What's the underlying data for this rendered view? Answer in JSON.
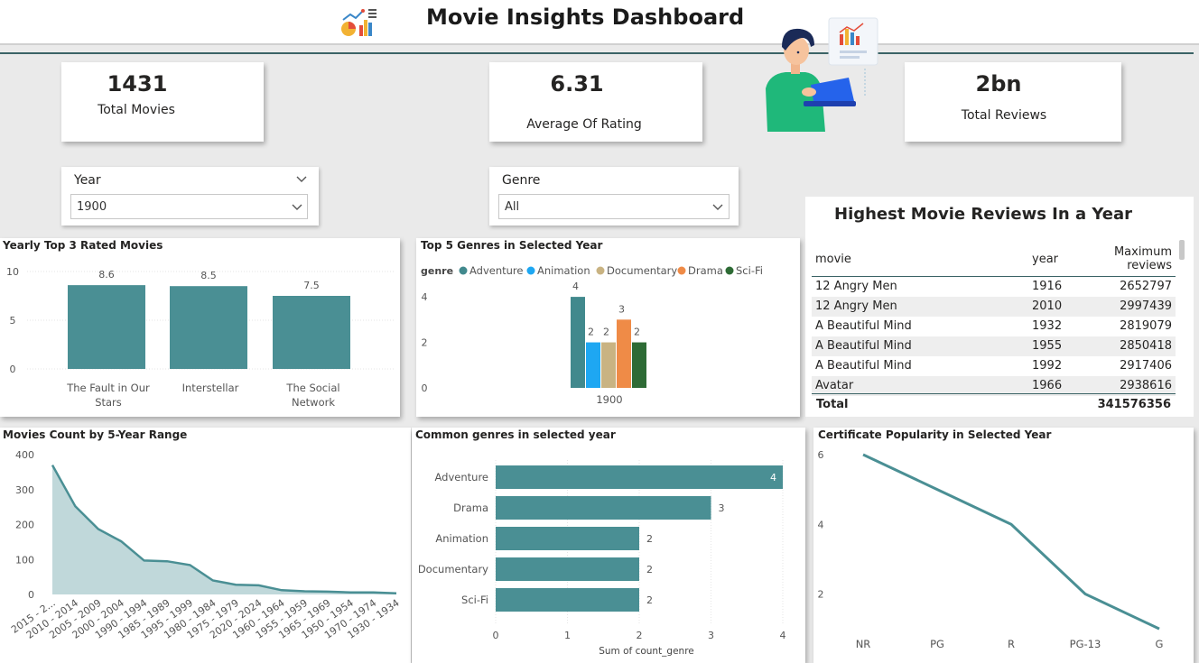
{
  "header": {
    "title": "Movie Insights Dashboard",
    "logo_icon": "chart-logo-icon"
  },
  "kpis": [
    {
      "value": "1431",
      "label": "Total Movies"
    },
    {
      "value": "6.31",
      "label": "Average Of Rating"
    },
    {
      "value": "2bn",
      "label": "Total Reviews"
    }
  ],
  "slicers": {
    "year": {
      "title": "Year",
      "selected": "1900"
    },
    "genre": {
      "title": "Genre",
      "selected": "All"
    }
  },
  "reviews_table": {
    "title": "Highest Movie Reviews In a Year",
    "columns": [
      "movie",
      "year",
      "Maximum reviews"
    ],
    "rows": [
      [
        "12 Angry Men",
        "1916",
        "2652797"
      ],
      [
        "12 Angry Men",
        "2010",
        "2997439"
      ],
      [
        "A Beautiful Mind",
        "1932",
        "2819079"
      ],
      [
        "A Beautiful Mind",
        "1955",
        "2850418"
      ],
      [
        "A Beautiful Mind",
        "1992",
        "2917406"
      ],
      [
        "Avatar",
        "1966",
        "2938616"
      ]
    ],
    "total_label": "Total",
    "total_value": "341576356"
  },
  "colors": {
    "teal": "#4a8f94",
    "adventure": "#41898d",
    "animation": "#1ea7f2",
    "documentary": "#c9b382",
    "drama": "#ef8b47",
    "scifi": "#2e6b35"
  },
  "chart_data": [
    {
      "id": "yearly-top3",
      "type": "bar",
      "title": "Yearly Top 3 Rated Movies",
      "categories": [
        "The Fault in Our Stars",
        "Interstellar",
        "The Social Network"
      ],
      "category_lines": [
        [
          "The Fault in Our",
          "Stars"
        ],
        [
          "Interstellar"
        ],
        [
          "The Social",
          "Network"
        ]
      ],
      "values": [
        8.6,
        8.5,
        7.5
      ],
      "value_labels": [
        "8.6",
        "8.5",
        "7.5"
      ],
      "ylim": [
        0,
        10
      ],
      "yticks": [
        "0",
        "5",
        "10"
      ],
      "grid": true
    },
    {
      "id": "top5-genres",
      "type": "bar",
      "title": "Top 5 Genres in Selected Year",
      "legend_title": "genre",
      "legend_position": "top-left",
      "categories": [
        "1900"
      ],
      "series": [
        {
          "name": "Adventure",
          "values": [
            4
          ]
        },
        {
          "name": "Animation",
          "values": [
            2
          ]
        },
        {
          "name": "Documentary",
          "values": [
            2
          ]
        },
        {
          "name": "Drama",
          "values": [
            3
          ]
        },
        {
          "name": "Sci-Fi",
          "values": [
            2
          ]
        }
      ],
      "ylim": [
        0,
        4.4
      ],
      "yticks": [
        "0",
        "2",
        "4"
      ]
    },
    {
      "id": "movies-5yr",
      "type": "area",
      "title": "Movies Count by 5-Year Range",
      "categories": [
        "2015 - 2...",
        "2010 - 2014",
        "2005 - 2009",
        "2000 - 2004",
        "1990 - 1994",
        "1985 - 1989",
        "1995 - 1999",
        "1980 - 1984",
        "1975 - 1979",
        "2020 - 2024",
        "1960 - 1964",
        "1955 - 1959",
        "1965 - 1969",
        "1950 - 1954",
        "1970 - 1974",
        "1930 - 1934"
      ],
      "values": [
        370,
        252,
        187,
        152,
        97,
        95,
        84,
        40,
        28,
        26,
        12,
        9,
        8,
        6,
        6,
        3
      ],
      "ylim": [
        0,
        400
      ],
      "yticks": [
        "0",
        "100",
        "200",
        "300",
        "400"
      ]
    },
    {
      "id": "common-genres",
      "type": "bar",
      "orientation": "horizontal",
      "title": "Common genres in selected year",
      "categories": [
        "Adventure",
        "Drama",
        "Animation",
        "Documentary",
        "Sci-Fi"
      ],
      "values": [
        4,
        3,
        2,
        2,
        2
      ],
      "value_labels": [
        "4",
        "3",
        "2",
        "2",
        "2"
      ],
      "xlim": [
        0,
        4
      ],
      "xticks": [
        "0",
        "1",
        "2",
        "3",
        "4"
      ],
      "xlabel": "Sum of count_genre",
      "grid": true
    },
    {
      "id": "certificate-popularity",
      "type": "line",
      "title": "Certificate Popularity in Selected Year",
      "categories": [
        "NR",
        "PG",
        "R",
        "PG-13",
        "G"
      ],
      "values": [
        6,
        5,
        4,
        2,
        1
      ],
      "ylim": [
        0.9,
        6
      ],
      "yticks": [
        "2",
        "4",
        "6"
      ]
    }
  ]
}
